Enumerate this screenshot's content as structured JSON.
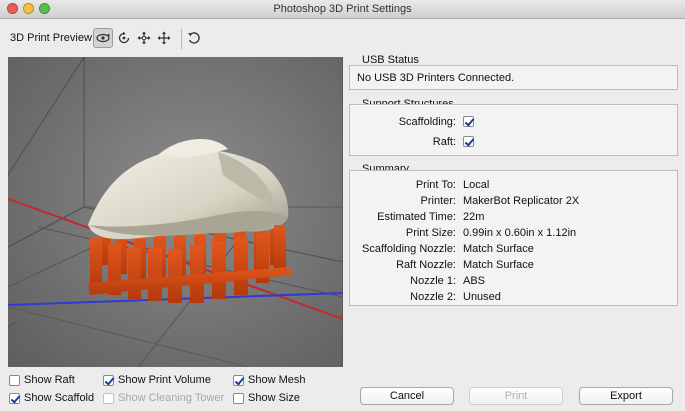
{
  "window": {
    "title": "Photoshop 3D Print Settings"
  },
  "toolbar": {
    "preview_label": "3D Print Preview",
    "icons": [
      "camera-orbit-icon",
      "rotate-icon",
      "pan-icon",
      "move-icon",
      "reset-view-icon"
    ]
  },
  "usb": {
    "title": "USB Status",
    "status": "No USB 3D Printers Connected."
  },
  "support": {
    "title": "Support Structures",
    "scaffolding_label": "Scaffolding:",
    "scaffolding_checked": true,
    "raft_label": "Raft:",
    "raft_checked": true
  },
  "summary": {
    "title": "Summary",
    "rows": [
      {
        "key": "Print To:",
        "value": "Local"
      },
      {
        "key": "Printer:",
        "value": "MakerBot Replicator 2X"
      },
      {
        "key": "Estimated Time:",
        "value": "22m"
      },
      {
        "key": "Print Size:",
        "value": "0.99in x 0.60in x 1.12in"
      },
      {
        "key": "Scaffolding Nozzle:",
        "value": "Match Surface"
      },
      {
        "key": "Raft Nozzle:",
        "value": "Match Surface"
      },
      {
        "key": "Nozzle 1:",
        "value": "ABS"
      },
      {
        "key": "Nozzle 2:",
        "value": "Unused"
      }
    ]
  },
  "view_options": {
    "show_raft": "Show Raft",
    "show_print_volume": "Show Print Volume",
    "show_mesh": "Show Mesh",
    "show_scaffold": "Show Scaffold",
    "show_cleaning_tower": "Show Cleaning Tower",
    "show_size": "Show Size"
  },
  "buttons": {
    "cancel": "Cancel",
    "print": "Print",
    "export": "Export"
  }
}
